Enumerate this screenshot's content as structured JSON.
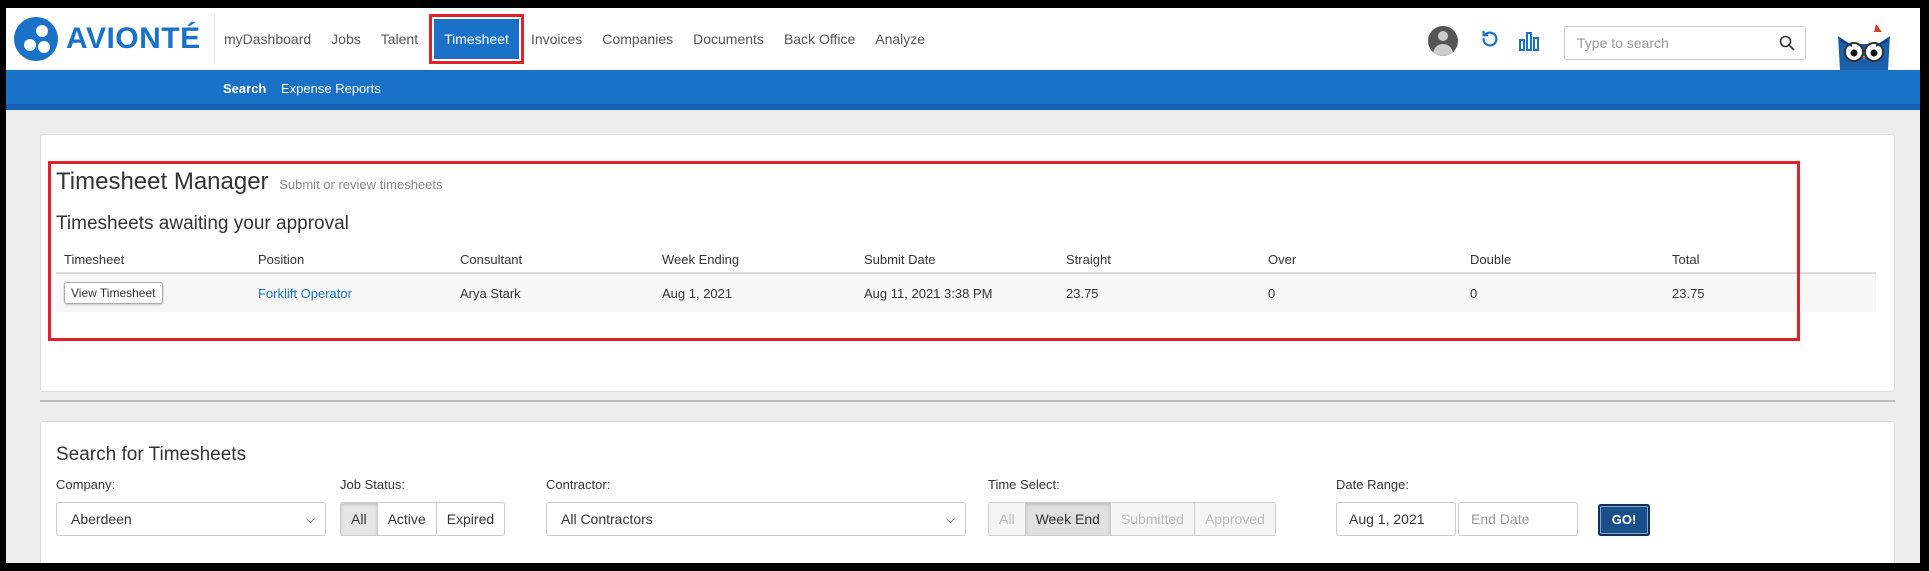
{
  "brand": {
    "name": "AVIONTÉ",
    "color": "#1a72c8"
  },
  "nav": {
    "items": [
      {
        "label": "myDashboard",
        "active": false
      },
      {
        "label": "Jobs",
        "active": false
      },
      {
        "label": "Talent",
        "active": false
      },
      {
        "label": "Timesheet",
        "active": true
      },
      {
        "label": "Invoices",
        "active": false
      },
      {
        "label": "Companies",
        "active": false
      },
      {
        "label": "Documents",
        "active": false
      },
      {
        "label": "Back Office",
        "active": false
      },
      {
        "label": "Analyze",
        "active": false
      }
    ],
    "search_placeholder": "Type to search",
    "icons": [
      "user-avatar-icon",
      "refresh-icon",
      "bar-chart-icon",
      "search-icon",
      "owl-mascot-icon"
    ]
  },
  "subnav": {
    "items": [
      "Search",
      "Expense Reports"
    ]
  },
  "manager": {
    "title": "Timesheet Manager",
    "subtitle": "Submit or review timesheets",
    "section_title": "Timesheets awaiting your approval",
    "columns": [
      "Timesheet",
      "Position",
      "Consultant",
      "Week Ending",
      "Submit Date",
      "Straight",
      "Over",
      "Double",
      "Total"
    ],
    "rows": [
      {
        "button": "View Timesheet",
        "position": "Forklift Operator",
        "consultant": "Arya Stark",
        "week_ending": "Aug 1, 2021",
        "submit_date": "Aug 11, 2021 3:38 PM",
        "straight": "23.75",
        "over": "0",
        "double": "0",
        "total": "23.75"
      }
    ]
  },
  "search_panel": {
    "title": "Search for Timesheets",
    "company": {
      "label": "Company:",
      "value": "Aberdeen"
    },
    "job_status": {
      "label": "Job Status:",
      "options": [
        "All",
        "Active",
        "Expired"
      ],
      "selected": "All"
    },
    "contractor": {
      "label": "Contractor:",
      "value": "All Contractors"
    },
    "time_select": {
      "label": "Time Select:",
      "options": [
        "All",
        "Week End",
        "Submitted",
        "Approved"
      ],
      "selected": "Week End"
    },
    "date_range": {
      "label": "Date Range:",
      "start": "Aug 1, 2021",
      "end_placeholder": "End Date"
    },
    "go_label": "GO!"
  }
}
